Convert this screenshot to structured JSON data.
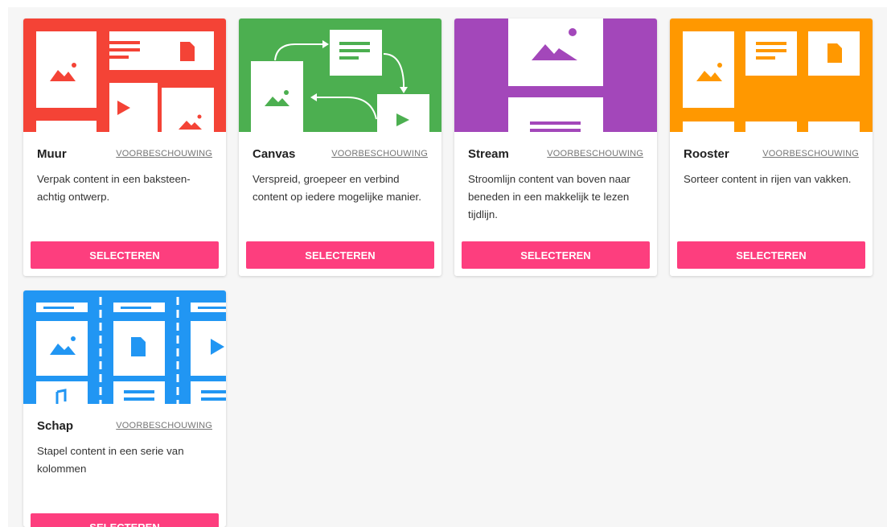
{
  "cards": [
    {
      "title": "Muur",
      "preview": "VOORBESCHOUWING",
      "description": "Verpak content in een baksteen-achtig ontwerp.",
      "button": "SELECTEREN",
      "color": "#f44336"
    },
    {
      "title": "Canvas",
      "preview": "VOORBESCHOUWING",
      "description": "Verspreid, groepeer en verbind content op iedere mogelijke manier.",
      "button": "SELECTEREN",
      "color": "#4caf50"
    },
    {
      "title": "Stream",
      "preview": "VOORBESCHOUWING",
      "description": "Stroomlijn content van boven naar beneden in een makkelijk te lezen tijdlijn.",
      "button": "SELECTEREN",
      "color": "#a347ba"
    },
    {
      "title": "Rooster",
      "preview": "VOORBESCHOUWING",
      "description": "Sorteer content in rijen van vakken.",
      "button": "SELECTEREN",
      "color": "#ff9800"
    },
    {
      "title": "Schap",
      "preview": "VOORBESCHOUWING",
      "description": "Stapel content in een serie van kolommen",
      "button": "SELECTEREN",
      "color": "#2196f3"
    }
  ],
  "colors": {
    "button": "#fd3e7e",
    "background": "#f6f6f6"
  }
}
